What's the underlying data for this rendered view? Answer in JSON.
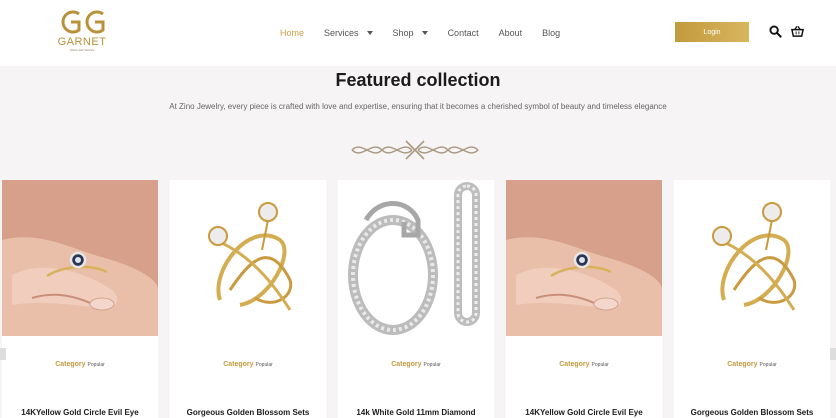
{
  "brand": {
    "name": "GARNET",
    "tagline": "Shine with Stories"
  },
  "nav": {
    "items": [
      {
        "label": "Home",
        "active": true,
        "dropdown": false
      },
      {
        "label": "Services",
        "active": false,
        "dropdown": true
      },
      {
        "label": "Shop",
        "active": false,
        "dropdown": true
      },
      {
        "label": "Contact",
        "active": false,
        "dropdown": false
      },
      {
        "label": "About",
        "active": false,
        "dropdown": false
      },
      {
        "label": "Blog",
        "active": false,
        "dropdown": false
      }
    ]
  },
  "header": {
    "login_label": "Login",
    "search_icon": "search-icon",
    "cart_icon": "basket-icon"
  },
  "colors": {
    "accent": "#c9a24a",
    "background": "#f6f4f4",
    "card": "#ffffff"
  },
  "featured": {
    "title": "Featured collection",
    "subtitle": "At Zino Jewelry, every piece is crafted with love and expertise, ensuring that it becomes a cherished symbol of beauty and timeless elegance"
  },
  "products": [
    {
      "image": "hand-with-evil-eye-ring",
      "category_label": "Category",
      "category_value": "Popular",
      "name": "14KYellow Gold Circle Evil Eye"
    },
    {
      "image": "golden-diamond-ring",
      "category_label": "Category",
      "category_value": "Popular",
      "name": "Gorgeous Golden Blossom Sets"
    },
    {
      "image": "white-gold-diamond-hoops",
      "category_label": "Category",
      "category_value": "Popular",
      "name": "14k White Gold 11mm Diamond"
    },
    {
      "image": "hand-with-evil-eye-ring",
      "category_label": "Category",
      "category_value": "Popular",
      "name": "14KYellow Gold Circle Evil Eye"
    },
    {
      "image": "golden-diamond-ring",
      "category_label": "Category",
      "category_value": "Popular",
      "name": "Gorgeous Golden Blossom Sets"
    }
  ]
}
